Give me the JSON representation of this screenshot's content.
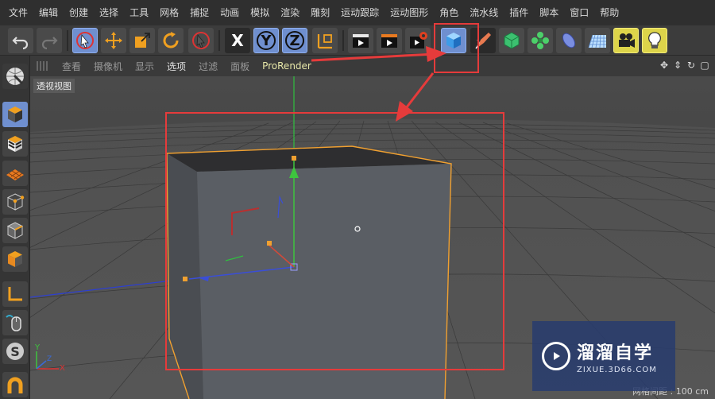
{
  "menu": [
    "文件",
    "编辑",
    "创建",
    "选择",
    "工具",
    "网格",
    "捕捉",
    "动画",
    "模拟",
    "渲染",
    "雕刻",
    "运动跟踪",
    "运动图形",
    "角色",
    "流水线",
    "插件",
    "脚本",
    "窗口",
    "帮助"
  ],
  "toolbar": {
    "icons": [
      "undo-icon",
      "redo-icon",
      "live-select-icon",
      "move-icon",
      "scale-icon",
      "rotate-icon",
      "recent-tool-icon",
      "x-axis-icon",
      "y-axis-icon",
      "z-axis-icon",
      "coordinate-system-icon",
      "render-view-icon",
      "render-picture-viewer-icon",
      "render-settings-icon",
      "cube-icon",
      "pen-spline-icon",
      "subdivision-icon",
      "array-cloner-icon",
      "deformer-icon",
      "floor-icon",
      "camera-icon",
      "light-icon"
    ],
    "x_label": "X",
    "y_label": "Y",
    "z_label": "Z"
  },
  "view_menu": [
    "查看",
    "摄像机",
    "显示",
    "选项",
    "过滤",
    "面板",
    "ProRender"
  ],
  "view_active": "选项",
  "viewport": {
    "label": "透视视图",
    "grid_spacing": "网格间距 : 100 cm",
    "axis_x": "X",
    "axis_y": "Y",
    "axis_z": "Z"
  },
  "watermark": {
    "title": "溜溜自学",
    "url": "ZIXUE.3D66.COM"
  },
  "colors": {
    "highlight_red": "#e53b3b",
    "selection_orange": "#f0a030",
    "y_axis_green": "#3ec43e",
    "z_axis_blue": "#3a4ed8"
  }
}
